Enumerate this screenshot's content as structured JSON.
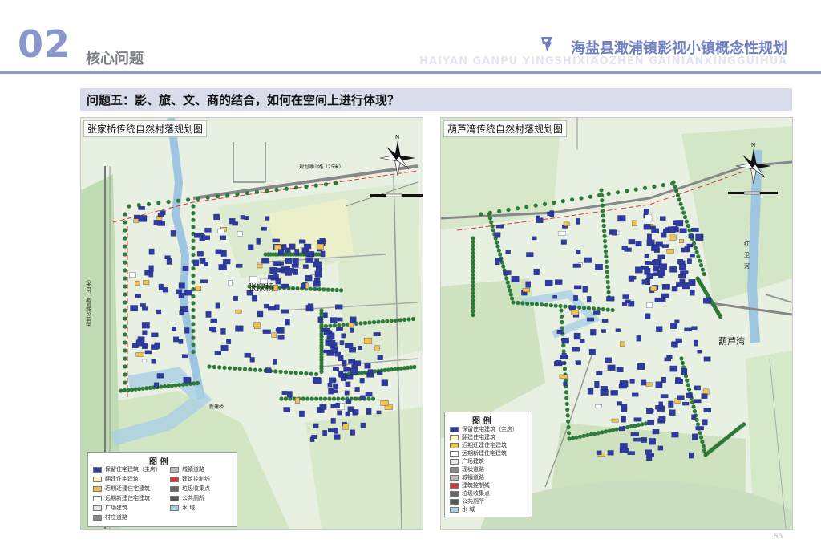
{
  "header": {
    "section_number": "02",
    "section_title": "核心问题",
    "project_title": "海盐县澉浦镇影视小镇概念性规划",
    "project_pinyin": "HAIYAN GANPU YINGSHIXIAOZHEN GAINIANXINGGUIHUA"
  },
  "question": "问题五：影、旅、文、商的结合，如何在空间上进行体现？",
  "maps": {
    "left": {
      "title": "张家桥传统自然村落规划图",
      "village_label": "张家桥",
      "road_label": "规划澉山路（25米）",
      "side_road_label": "规划沿湖西路（33米）",
      "bridge_label": "新建桥",
      "legend": {
        "title": "图  例",
        "items": [
          "保留住宅建筑（主房）",
          "翻建住宅建筑",
          "近期迁建住宅建筑",
          "远期新建住宅建筑",
          "广场建筑",
          "村庄道路",
          "城镇道路",
          "建筑控制线",
          "垃圾收集点",
          "公共厕所",
          "水  域"
        ]
      }
    },
    "right": {
      "title": "葫芦湾传统自然村落规划图",
      "village_label": "葫芦湾",
      "river_label": "红卫河",
      "legend": {
        "title": "图  例",
        "items": [
          "保留住宅建筑（主房）",
          "翻建住宅建筑",
          "近期迁建住宅建筑",
          "远期新建住宅建筑",
          "广场建筑",
          "现状道路",
          "城镇道路",
          "建筑控制线",
          "垃圾收集点",
          "公共厕所",
          "水  域"
        ]
      }
    }
  },
  "colors": {
    "accent": "#8d98cf",
    "title": "#7180c2",
    "building": "#2e3a9e",
    "tree": "#2f7a3a",
    "water": "#a9cfe6",
    "field": "#cfe3c2",
    "road_red": "#d13b3b"
  },
  "page_number": "66"
}
